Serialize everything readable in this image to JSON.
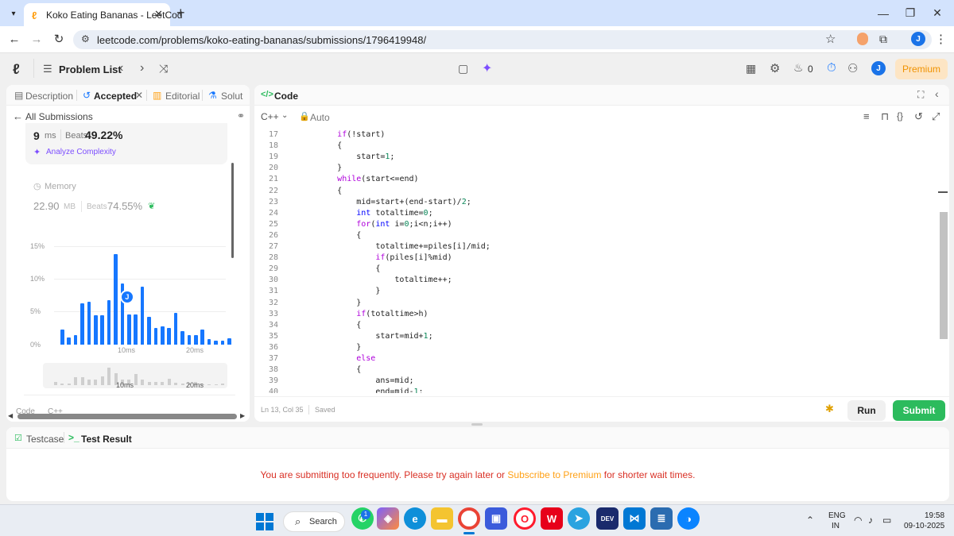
{
  "browser": {
    "tab_title": "Koko Eating Bananas - LeetCod",
    "url": "leetcode.com/problems/koko-eating-bananas/submissions/1796419948/",
    "new_tab": "+",
    "profile_initial": "J"
  },
  "header": {
    "problem_list": "Problem List",
    "streak": "0",
    "premium": "Premium",
    "avatar": "J"
  },
  "left_tabs": {
    "description": "Description",
    "accepted": "Accepted",
    "editorial": "Editorial",
    "solutions": "Solut"
  },
  "submissions": {
    "back": "All Submissions",
    "runtime_value": "9",
    "runtime_unit": "ms",
    "beats_label": "Beats",
    "runtime_beats": "49.22%",
    "analyze": "Analyze Complexity",
    "memory_title": "Memory",
    "memory_value": "22.90",
    "memory_unit": "MB",
    "memory_beats": "74.55%",
    "code_label": "Code",
    "code_lang": "C++"
  },
  "chart_data": {
    "type": "bar",
    "y_ticks": [
      "15%",
      "10%",
      "5%",
      "0%"
    ],
    "x_ticks": [
      "10ms",
      "20ms"
    ],
    "values": [
      2.3,
      1.1,
      1.4,
      6.3,
      6.5,
      4.5,
      4.5,
      6.8,
      13.8,
      9.3,
      4.6,
      4.6,
      8.8,
      4.2,
      2.5,
      2.8,
      2.5,
      4.8,
      2.1,
      1.5,
      1.4,
      2.3,
      0.8,
      0.6,
      0.6,
      1.0
    ],
    "user_bin_index": 9,
    "user_marker": "J",
    "ylim": [
      0,
      15
    ],
    "mini_ticks": [
      "10ms",
      "20ms"
    ]
  },
  "code_panel": {
    "title": "Code",
    "language": "C++",
    "auto": "Auto",
    "status_pos": "Ln 13, Col 35",
    "status_saved": "Saved",
    "run": "Run",
    "submit": "Submit"
  },
  "code_lines": [
    {
      "n": "17",
      "t": "        if(!start)"
    },
    {
      "n": "18",
      "t": "        {"
    },
    {
      "n": "19",
      "t": "            start=1;"
    },
    {
      "n": "20",
      "t": "        }"
    },
    {
      "n": "21",
      "t": "        while(start<=end)"
    },
    {
      "n": "22",
      "t": "        {"
    },
    {
      "n": "23",
      "t": "            mid=start+(end-start)/2;"
    },
    {
      "n": "24",
      "t": "            int totaltime=0;"
    },
    {
      "n": "25",
      "t": "            for(int i=0;i<n;i++)"
    },
    {
      "n": "26",
      "t": "            {"
    },
    {
      "n": "27",
      "t": "                totaltime+=piles[i]/mid;"
    },
    {
      "n": "28",
      "t": "                if(piles[i]%mid)"
    },
    {
      "n": "29",
      "t": "                {"
    },
    {
      "n": "30",
      "t": "                    totaltime++;"
    },
    {
      "n": "31",
      "t": "                }"
    },
    {
      "n": "32",
      "t": "            }"
    },
    {
      "n": "33",
      "t": "            if(totaltime>h)"
    },
    {
      "n": "34",
      "t": "            {"
    },
    {
      "n": "35",
      "t": "                start=mid+1;"
    },
    {
      "n": "36",
      "t": "            }"
    },
    {
      "n": "37",
      "t": "            else"
    },
    {
      "n": "38",
      "t": "            {"
    },
    {
      "n": "39",
      "t": "                ans=mid;"
    },
    {
      "n": "40",
      "t": "                end=mid-1;"
    }
  ],
  "bottom": {
    "testcase": "Testcase",
    "test_result": "Test Result",
    "msg_part1": "You are submitting too frequently. Please try again later or ",
    "msg_link": "Subscribe to Premium",
    "msg_part2": " for shorter wait times."
  },
  "taskbar": {
    "search": "Search",
    "badge": "1",
    "lang_top": "ENG",
    "lang_bottom": "IN",
    "time": "19:58",
    "date": "09-10-2025"
  },
  "colors": {
    "accent_blue": "#1677ff",
    "green": "#2cbb5d",
    "error_red": "#d93025",
    "link_orange": "#ffa116"
  }
}
